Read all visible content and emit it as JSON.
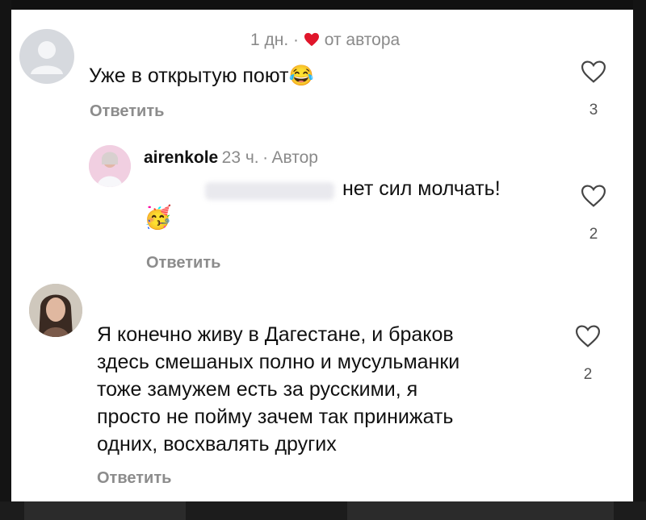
{
  "comments": [
    {
      "meta_time": "1 дн.",
      "meta_sep": "·",
      "meta_author_note": "от автора",
      "text": "Уже в открытую поют",
      "emoji": "😂",
      "reply_label": "Ответить",
      "likes": "3",
      "reply": {
        "username": "airenkole",
        "meta_time": "23 ч.",
        "meta_sep": "·",
        "meta_author": "Автор",
        "text": "нет сил молчать!",
        "emoji": "🥳",
        "reply_label": "Ответить",
        "likes": "2"
      }
    },
    {
      "text_lines": [
        "Я конечно живу в Дагестане, и браков",
        "здесь смешаных полно и мусульманки",
        "тоже замужем есть за русскими, я",
        "просто не пойму зачем так принижать",
        "одних, восхвалять других"
      ],
      "reply_label": "Ответить",
      "likes": "2"
    }
  ],
  "icons": {
    "heart_filled": "heart-filled-icon",
    "heart_outline": "heart-outline-icon",
    "avatar_default": "avatar-default-icon"
  },
  "colors": {
    "heart_red": "#e0162b",
    "meta_gray": "#8a8a8a",
    "text": "#111111"
  }
}
